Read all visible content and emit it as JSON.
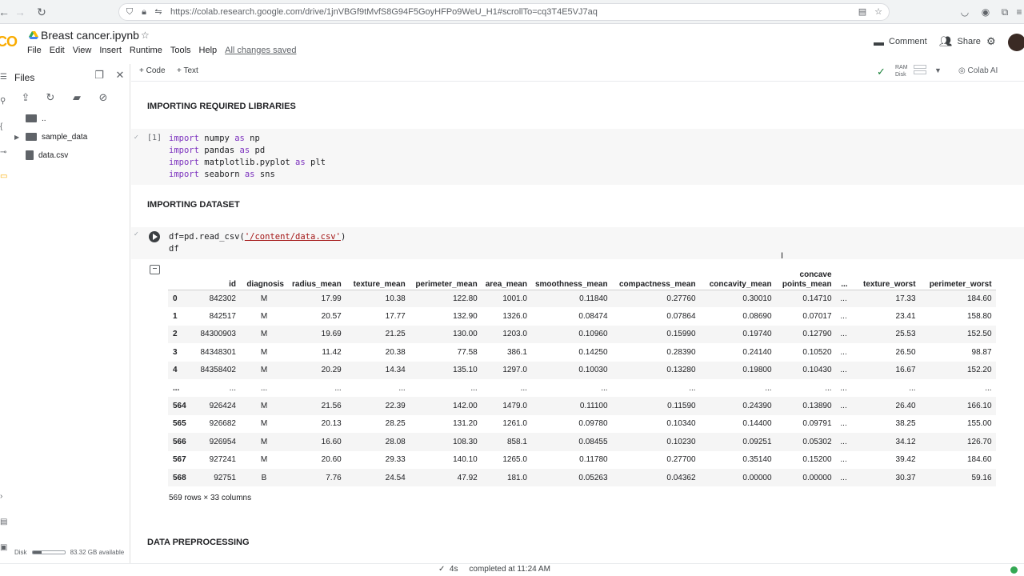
{
  "browser": {
    "url": "https://colab.research.google.com/drive/1jnVBGf9tMvfS8G94F5GoyHFPo9WeU_H1#scrollTo=cq3T4E5VJ7aq"
  },
  "header": {
    "logo_text": "CO",
    "notebook_title": "Breast cancer.ipynb",
    "menu": [
      "File",
      "Edit",
      "View",
      "Insert",
      "Runtime",
      "Tools",
      "Help"
    ],
    "save_status": "All changes saved",
    "comment_label": "Comment",
    "share_label": "Share"
  },
  "sidebar": {
    "title": "Files",
    "parent_dir": "..",
    "folder": "sample_data",
    "file": "data.csv",
    "disk_label": "Disk",
    "disk_available": "83.32 GB available",
    "disk_used_fraction": 0.28
  },
  "toolbar": {
    "code_label": "+ Code",
    "text_label": "+ Text",
    "ram_label": "RAM",
    "disk_label": "Disk",
    "colab_ai_label": "Colab AI"
  },
  "cells": {
    "section1": "IMPORTING REQUIRED LIBRARIES",
    "cell1_count": "[1]",
    "cell1_lines": [
      {
        "kw": "import",
        "rest": " numpy ",
        "kw2": "as",
        "rest2": " np"
      },
      {
        "kw": "import",
        "rest": " pandas ",
        "kw2": "as",
        "rest2": " pd"
      },
      {
        "kw": "import",
        "rest": " matplotlib.pyplot ",
        "kw2": "as",
        "rest2": " plt"
      },
      {
        "kw": "import",
        "rest": " seaborn ",
        "kw2": "as",
        "rest2": " sns"
      }
    ],
    "section2": "IMPORTING DATASET",
    "cell2_pre": "df=pd.read_csv(",
    "cell2_str": "'/content/data.csv'",
    "cell2_post": ")",
    "cell2_line2": "df",
    "section3": "DATA PREPROCESSING"
  },
  "table": {
    "columns": [
      "",
      "id",
      "diagnosis",
      "radius_mean",
      "texture_mean",
      "perimeter_mean",
      "area_mean",
      "smoothness_mean",
      "compactness_mean",
      "concavity_mean",
      "concave\npoints_mean",
      "...",
      "texture_worst",
      "perimeter_worst"
    ],
    "rows": [
      [
        "0",
        "842302",
        "M",
        "17.99",
        "10.38",
        "122.80",
        "1001.0",
        "0.11840",
        "0.27760",
        "0.30010",
        "0.14710",
        "...",
        "17.33",
        "184.60"
      ],
      [
        "1",
        "842517",
        "M",
        "20.57",
        "17.77",
        "132.90",
        "1326.0",
        "0.08474",
        "0.07864",
        "0.08690",
        "0.07017",
        "...",
        "23.41",
        "158.80"
      ],
      [
        "2",
        "84300903",
        "M",
        "19.69",
        "21.25",
        "130.00",
        "1203.0",
        "0.10960",
        "0.15990",
        "0.19740",
        "0.12790",
        "...",
        "25.53",
        "152.50"
      ],
      [
        "3",
        "84348301",
        "M",
        "11.42",
        "20.38",
        "77.58",
        "386.1",
        "0.14250",
        "0.28390",
        "0.24140",
        "0.10520",
        "...",
        "26.50",
        "98.87"
      ],
      [
        "4",
        "84358402",
        "M",
        "20.29",
        "14.34",
        "135.10",
        "1297.0",
        "0.10030",
        "0.13280",
        "0.19800",
        "0.10430",
        "...",
        "16.67",
        "152.20"
      ],
      [
        "...",
        "...",
        "...",
        "...",
        "...",
        "...",
        "...",
        "...",
        "...",
        "...",
        "...",
        "...",
        "...",
        "..."
      ],
      [
        "564",
        "926424",
        "M",
        "21.56",
        "22.39",
        "142.00",
        "1479.0",
        "0.11100",
        "0.11590",
        "0.24390",
        "0.13890",
        "...",
        "26.40",
        "166.10"
      ],
      [
        "565",
        "926682",
        "M",
        "20.13",
        "28.25",
        "131.20",
        "1261.0",
        "0.09780",
        "0.10340",
        "0.14400",
        "0.09791",
        "...",
        "38.25",
        "155.00"
      ],
      [
        "566",
        "926954",
        "M",
        "16.60",
        "28.08",
        "108.30",
        "858.1",
        "0.08455",
        "0.10230",
        "0.09251",
        "0.05302",
        "...",
        "34.12",
        "126.70"
      ],
      [
        "567",
        "927241",
        "M",
        "20.60",
        "29.33",
        "140.10",
        "1265.0",
        "0.11780",
        "0.27700",
        "0.35140",
        "0.15200",
        "...",
        "39.42",
        "184.60"
      ],
      [
        "568",
        "92751",
        "B",
        "7.76",
        "24.54",
        "47.92",
        "181.0",
        "0.05263",
        "0.04362",
        "0.00000",
        "0.00000",
        "...",
        "30.37",
        "59.16"
      ]
    ],
    "shape_note": "569 rows × 33 columns"
  },
  "status": {
    "text": "✓  4s     completed at 11:24 AM"
  },
  "colors": {
    "keyword": "#7a2fbd",
    "string": "#a31515",
    "ok_green": "#188038",
    "logo_orange": "#f9ab00"
  }
}
